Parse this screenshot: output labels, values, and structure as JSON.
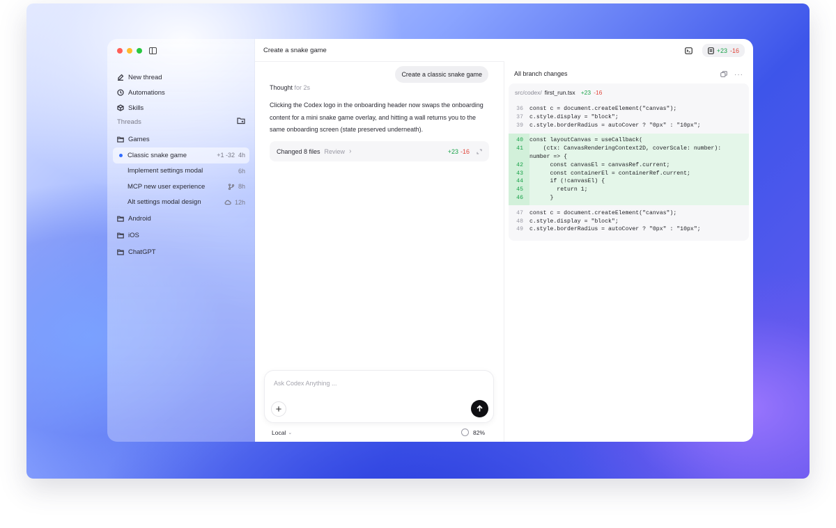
{
  "window": {
    "title": "Create a snake game",
    "header_diff": {
      "added": "+23",
      "removed": "-16"
    }
  },
  "sidebar": {
    "nav": [
      {
        "label": "New thread",
        "icon": "compose-icon"
      },
      {
        "label": "Automations",
        "icon": "clock-icon"
      },
      {
        "label": "Skills",
        "icon": "cube-icon"
      }
    ],
    "threads_heading": "Threads",
    "folders": [
      {
        "label": "Games",
        "threads": [
          {
            "label": "Classic snake game",
            "meta": "+1 -32",
            "time": "4h",
            "active": true,
            "unread": true
          },
          {
            "label": "Implement settings modal",
            "meta": "",
            "time": "6h"
          },
          {
            "label": "MCP new user experience",
            "meta_icon": "branch-icon",
            "time": "8h"
          },
          {
            "label": "Alt settings modal design",
            "meta_icon": "cloud-icon",
            "time": "12h"
          }
        ]
      },
      {
        "label": "Android"
      },
      {
        "label": "iOS"
      },
      {
        "label": "ChatGPT"
      }
    ]
  },
  "chat": {
    "user_message": "Create a classic snake game",
    "thought_label": "Thought",
    "thought_duration": "for 2s",
    "response": "Clicking the Codex logo in the onboarding header now swaps the onboarding content for a mini snake game overlay, and hitting a wall returns you to the same onboarding screen (state preserved underneath).",
    "changed_files": {
      "label": "Changed 8 files",
      "review": "Review",
      "added": "+23",
      "removed": "-16"
    },
    "composer": {
      "placeholder": "Ask Codex Anything ..."
    },
    "footer": {
      "environment": "Local",
      "context_usage": "82%"
    }
  },
  "diff": {
    "heading": "All branch changes",
    "file": {
      "path": "src/codex/",
      "name": "first_run.tsx",
      "added": "+23",
      "removed": "-16"
    },
    "hunks": [
      {
        "type": "plain",
        "lines": [
          {
            "n": "36",
            "code": "const c = document.createElement(\"canvas\");"
          },
          {
            "n": "37",
            "code": "c.style.display = \"block\";"
          },
          {
            "n": "39",
            "code": "c.style.borderRadius = autoCover ? \"0px\" : \"10px\";"
          }
        ]
      },
      {
        "type": "added",
        "lines": [
          {
            "n": "40",
            "code": "const layoutCanvas = useCallback("
          },
          {
            "n": "41",
            "code": "    (ctx: CanvasRenderingContext2D, coverScale: number):"
          },
          {
            "n": "",
            "code": "number => {"
          },
          {
            "n": "42",
            "code": "      const canvasEl = canvasRef.current;"
          },
          {
            "n": "43",
            "code": "      const containerEl = containerRef.current;"
          },
          {
            "n": "44",
            "code": "      if (!canvasEl) {"
          },
          {
            "n": "45",
            "code": "        return 1;"
          },
          {
            "n": "46",
            "code": "      }"
          }
        ]
      },
      {
        "type": "plain",
        "lines": [
          {
            "n": "47",
            "code": "const c = document.createElement(\"canvas\");"
          },
          {
            "n": "48",
            "code": "c.style.display = \"block\";"
          },
          {
            "n": "49",
            "code": "c.style.borderRadius = autoCover ? \"0px\" : \"10px\";"
          }
        ]
      }
    ]
  }
}
